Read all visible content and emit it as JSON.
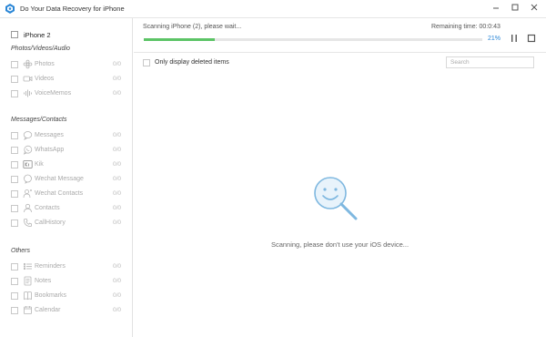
{
  "window": {
    "title": "Do Your Data Recovery for iPhone",
    "accent": "#2a86d6"
  },
  "sidebar": {
    "device": "iPhone 2",
    "categories": [
      {
        "title": "Photos/Videos/Audio",
        "items": [
          {
            "label": "Photos",
            "count": "0/0",
            "icon": "flower-icon"
          },
          {
            "label": "Videos",
            "count": "0/0",
            "icon": "video-camera-icon"
          },
          {
            "label": "VoiceMemos",
            "count": "0/0",
            "icon": "sound-wave-icon"
          }
        ]
      },
      {
        "title": "Messages/Contacts",
        "items": [
          {
            "label": "Messages",
            "count": "0/0",
            "icon": "chat-bubble-icon"
          },
          {
            "label": "WhatsApp",
            "count": "0/0",
            "icon": "whatsapp-icon"
          },
          {
            "label": "Kik",
            "count": "0/0",
            "icon": "kik-icon"
          },
          {
            "label": "Wechat Message",
            "count": "0/0",
            "icon": "wechat-icon"
          },
          {
            "label": "Wechat Contacts",
            "count": "0/0",
            "icon": "wechat-contact-icon"
          },
          {
            "label": "Contacts",
            "count": "0/0",
            "icon": "person-icon"
          },
          {
            "label": "CallHistory",
            "count": "0/0",
            "icon": "phone-icon"
          }
        ]
      },
      {
        "title": "Others",
        "items": [
          {
            "label": "Reminders",
            "count": "0/0",
            "icon": "reminder-list-icon"
          },
          {
            "label": "Notes",
            "count": "0/0",
            "icon": "note-icon"
          },
          {
            "label": "Bookmarks",
            "count": "0/0",
            "icon": "bookmark-icon"
          },
          {
            "label": "Calendar",
            "count": "0/0",
            "icon": "calendar-icon"
          }
        ]
      }
    ]
  },
  "scan": {
    "status": "Scanning iPhone (2), please wait...",
    "remaining": "Remaining time: 00:0:43",
    "percent_label": "21%",
    "progress": 0.21,
    "progress_color": "#5cc466",
    "message": "Scanning, please don't use your iOS device..."
  },
  "filter": {
    "label": "Only display deleted items"
  },
  "search": {
    "placeholder": "Search"
  }
}
